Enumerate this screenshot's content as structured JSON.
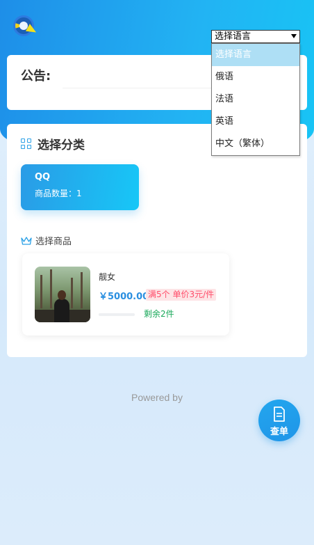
{
  "header": {
    "language_select": {
      "selected": "选择语言",
      "options": [
        "选择语言",
        "俄语",
        "法语",
        "英语",
        "中文（繁体）"
      ]
    }
  },
  "notice": {
    "title": "公告:"
  },
  "categories": {
    "heading": "选择分类",
    "items": [
      {
        "name": "QQ",
        "count_text": "商品数量：1"
      }
    ]
  },
  "goods": {
    "heading": "选择商品",
    "items": [
      {
        "name": "靓女",
        "price": "￥5000.00",
        "tag": "满5个 单价3元/件",
        "stock": "剩余2件"
      }
    ]
  },
  "footer": {
    "powered_by": "Powered by"
  },
  "fab": {
    "label": "查单"
  },
  "colors": {
    "accent": "#1e9be9",
    "price": "#2b8fe0",
    "tag": "#ff4d6a",
    "stock": "#1aa85a"
  }
}
